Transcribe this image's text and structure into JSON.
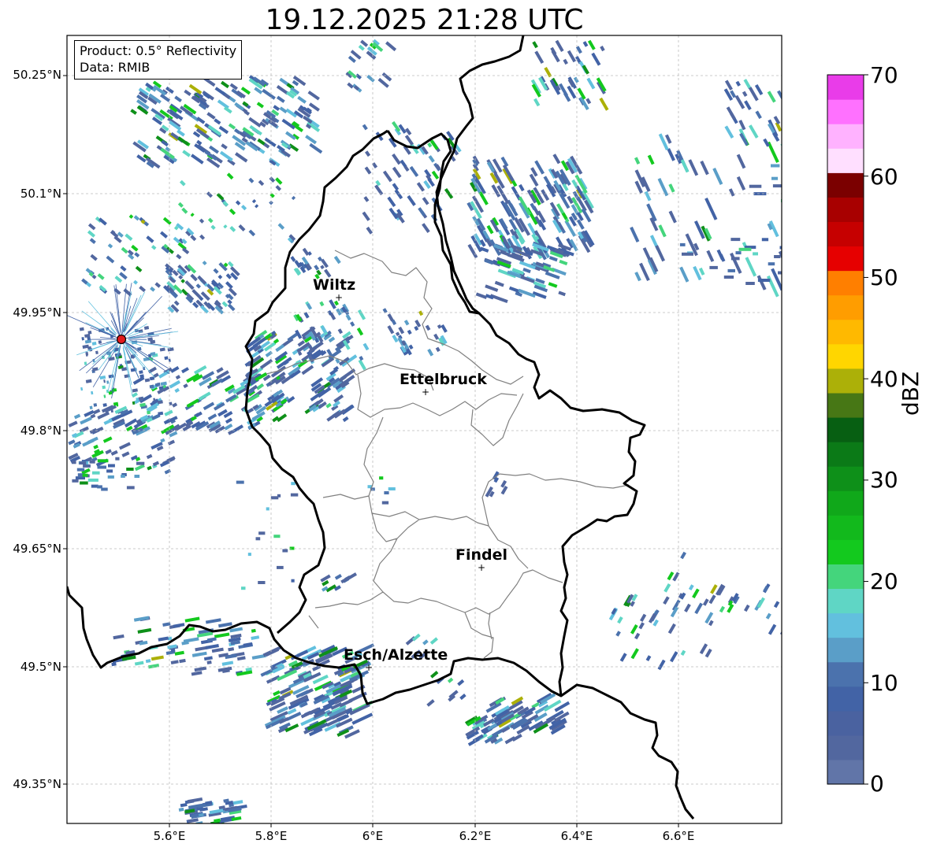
{
  "title": "19.12.2025 21:28 UTC",
  "info": {
    "product": "Product: 0.5° Reflectivity",
    "source": "Data: RMIB"
  },
  "lat_labels": [
    "50.25°N",
    "50.1°N",
    "49.95°N",
    "49.8°N",
    "49.65°N",
    "49.5°N",
    "49.35°N"
  ],
  "lon_labels": [
    "5.6°E",
    "5.8°E",
    "6°E",
    "6.2°E",
    "6.4°E",
    "6.6°E"
  ],
  "cities": [
    "Wiltz",
    "Ettelbruck",
    "Findel",
    "Esch/Alzette"
  ],
  "radar_site_color": "#e31a1c",
  "colorbar": {
    "unit": "dBZ",
    "ticks": [
      "70",
      "60",
      "50",
      "40",
      "30",
      "20",
      "10",
      "0"
    ],
    "colors": [
      "#6175a8",
      "#52679f",
      "#4a62a0",
      "#4263a6",
      "#4b72ad",
      "#5a9ec8",
      "#62c0de",
      "#5fd6c5",
      "#44d57c",
      "#13c91e",
      "#12b91c",
      "#10a81a",
      "#0e9019",
      "#0b7a17",
      "#075f12",
      "#477715",
      "#acb008",
      "#ffd600",
      "#ffb900",
      "#ff9d00",
      "#ff7f00",
      "#e60000",
      "#c60000",
      "#a80000",
      "#7b0000",
      "#ffdfff",
      "#ffb2ff",
      "#ff71ff",
      "#e93ce9"
    ]
  }
}
